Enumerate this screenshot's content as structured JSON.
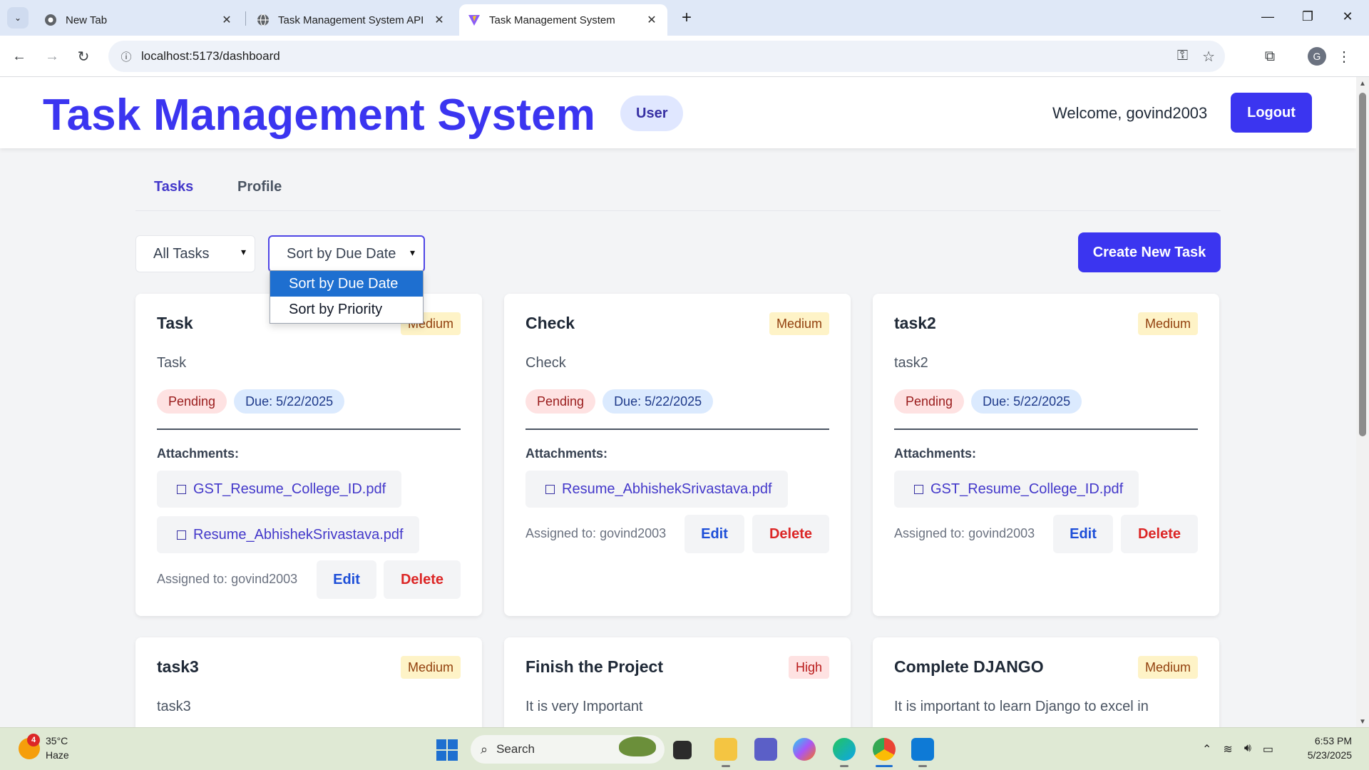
{
  "browser": {
    "tabs": [
      {
        "title": "New Tab",
        "close": "✕"
      },
      {
        "title": "Task Management System API",
        "close": "✕"
      },
      {
        "title": "Task Management System",
        "close": "✕"
      }
    ],
    "new_tab": "+",
    "url": "localhost:5173/dashboard"
  },
  "header": {
    "brand": "Task Management System",
    "role": "User",
    "welcome": "Welcome, govind2003",
    "logout": "Logout"
  },
  "nav": {
    "tasks": "Tasks",
    "profile": "Profile"
  },
  "filters": {
    "status_selected": "All Tasks",
    "sort_selected": "Sort by Due Date",
    "sort_options": [
      "Sort by Due Date",
      "Sort by Priority"
    ],
    "create": "Create New Task"
  },
  "labels": {
    "attachments": "Attachments:",
    "edit": "Edit",
    "delete": "Delete"
  },
  "tasks": [
    {
      "title": "Task",
      "priority": "Medium",
      "description": "Task",
      "status": "Pending",
      "due": "Due: 5/22/2025",
      "attachments": [
        "GST_Resume_College_ID.pdf",
        "Resume_AbhishekSrivastava.pdf"
      ],
      "assigned": "Assigned to: govind2003"
    },
    {
      "title": "Check",
      "priority": "Medium",
      "description": "Check",
      "status": "Pending",
      "due": "Due: 5/22/2025",
      "attachments": [
        "Resume_AbhishekSrivastava.pdf"
      ],
      "assigned": "Assigned to: govind2003"
    },
    {
      "title": "task2",
      "priority": "Medium",
      "description": "task2",
      "status": "Pending",
      "due": "Due: 5/22/2025",
      "attachments": [
        "GST_Resume_College_ID.pdf"
      ],
      "assigned": "Assigned to: govind2003"
    },
    {
      "title": "task3",
      "priority": "Medium",
      "description": "task3"
    },
    {
      "title": "Finish the Project",
      "priority": "High",
      "description": "It is very Important"
    },
    {
      "title": "Complete DJANGO",
      "priority": "Medium",
      "description": "It is important to learn Django to excel in"
    }
  ],
  "taskbar": {
    "weather_temp": "35°C",
    "weather_desc": "Haze",
    "weather_badge": "4",
    "search": "Search",
    "time": "6:53 PM",
    "date": "5/23/2025"
  }
}
